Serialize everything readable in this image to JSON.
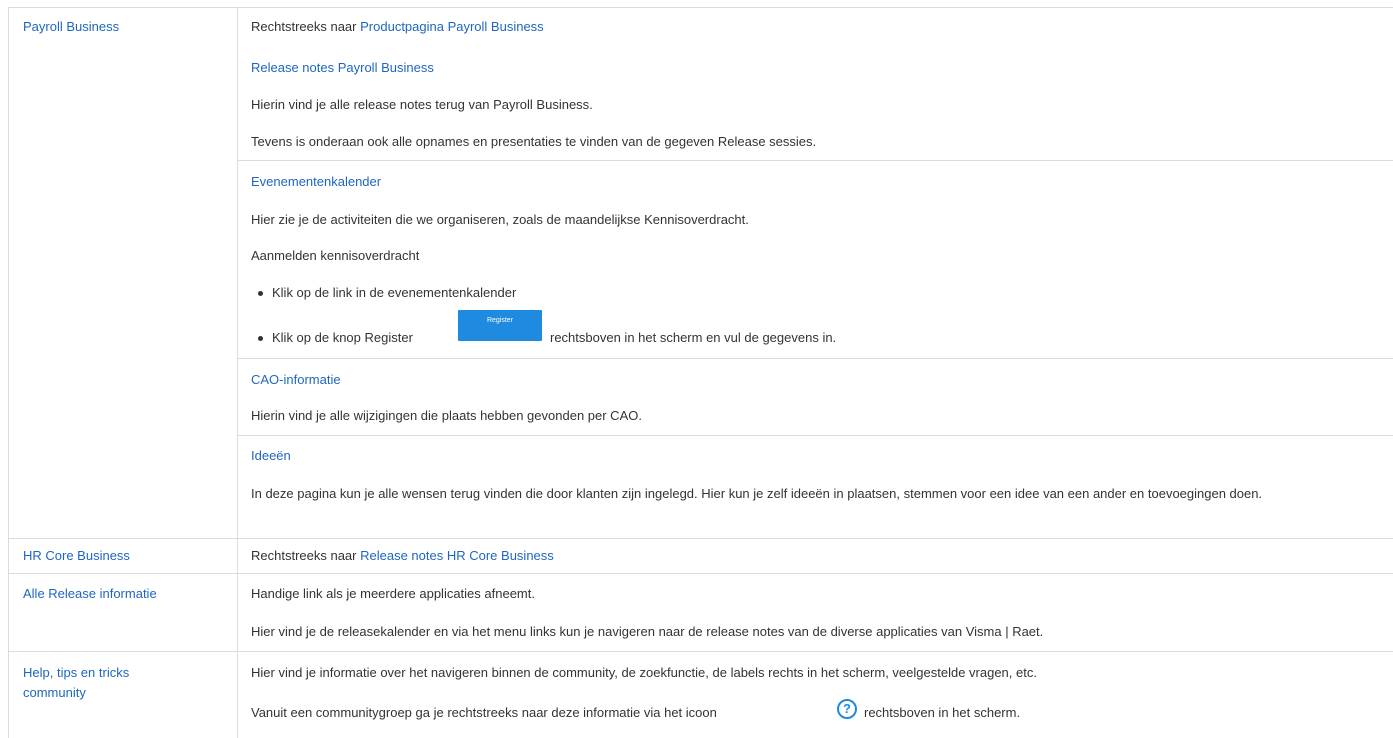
{
  "rows": {
    "payroll": {
      "label": "Payroll Business",
      "direct_prefix": "Rechtstreeks naar",
      "direct_link": "Productpagina Payroll Business",
      "release_notes_link": "Release notes Payroll Business",
      "release_notes_text1": "Hierin vind je alle release notes terug van Payroll Business.",
      "release_notes_text2": "Tevens is onderaan ook alle opnames en presentaties te vinden van de gegeven Release sessies.",
      "events_link": "Evenementenkalender",
      "events_text": "Hier zie je de activiteiten die we organiseren, zoals de maandelijkse Kennisoverdracht.",
      "events_register_heading": "Aanmelden kennisoverdracht",
      "events_bullet1": "Klik op de link in de evenementenkalender",
      "events_bullet2_before": "Klik op de knop Register",
      "events_bullet2_button": "Register",
      "events_bullet2_after": "rechtsboven in het scherm en vul de gegevens in.",
      "cao_link": "CAO-informatie",
      "cao_text": "Hierin vind je alle wijzigingen die plaats hebben gevonden per CAO.",
      "ideas_link": "Ideeën",
      "ideas_text": "In deze pagina kun je alle wensen terug vinden die door klanten zijn ingelegd. Hier kun je zelf ideeën in plaatsen, stemmen voor een idee van een ander en toevoegingen doen."
    },
    "hr_core": {
      "label": "HR Core Business",
      "direct_prefix": "Rechtstreeks naar",
      "direct_link": "Release notes HR Core Business"
    },
    "all_release": {
      "label": "Alle Release informatie",
      "text1": "Handige link als je meerdere applicaties afneemt.",
      "text2": "Hier vind je de releasekalender en via het menu links kun je navigeren naar de release notes van de diverse applicaties van Visma | Raet."
    },
    "help": {
      "label_line1": "Help, tips en tricks",
      "label_line2": "community",
      "text1": "Hier vind je informatie over het navigeren binnen de community, de zoekfunctie, de labels rechts in het scherm, veelgestelde vragen, etc.",
      "text2_before": "Vanuit een communitygroep ga je rechtstreeks naar deze informatie via het icoon",
      "text2_after": "rechtsboven in het scherm.",
      "icon": "question-circle-icon"
    }
  },
  "colors": {
    "link": "#1f66c2",
    "border": "#d8dde3",
    "button": "#1f8be0",
    "text": "#333333"
  }
}
